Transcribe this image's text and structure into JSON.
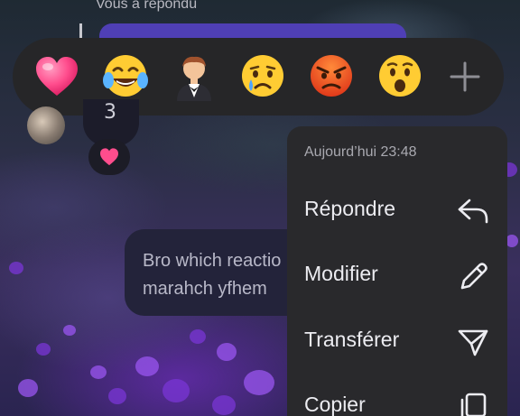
{
  "chat": {
    "replied_label": "Vous a répondu",
    "small_bubble_text": "3",
    "message_text_line1": "Bro which reactio",
    "message_text_line2": "marahch yfhem"
  },
  "reactions": [
    {
      "icon": "pink-heart-icon",
      "label": "💗"
    },
    {
      "icon": "tears-of-joy-icon",
      "label": "😂"
    },
    {
      "icon": "person-in-tuxedo-icon",
      "label": "🤵"
    },
    {
      "icon": "crying-face-icon",
      "label": "😢"
    },
    {
      "icon": "angry-face-icon",
      "label": "😡"
    },
    {
      "icon": "surprised-face-icon",
      "label": "😮"
    },
    {
      "icon": "plus-icon",
      "label": "+"
    }
  ],
  "context_menu": {
    "timestamp": "Aujourd’hui 23:48",
    "items": [
      {
        "label": "Répondre",
        "icon": "reply-icon"
      },
      {
        "label": "Modifier",
        "icon": "pencil-icon"
      },
      {
        "label": "Transférer",
        "icon": "send-icon"
      },
      {
        "label": "Copier",
        "icon": "copy-icon"
      }
    ]
  },
  "colors": {
    "menu_bg": "#29292c",
    "reaction_bar_bg": "#262628",
    "reply_bubble": "#4f3fb5",
    "heart_pink": "#ff4d8d"
  }
}
